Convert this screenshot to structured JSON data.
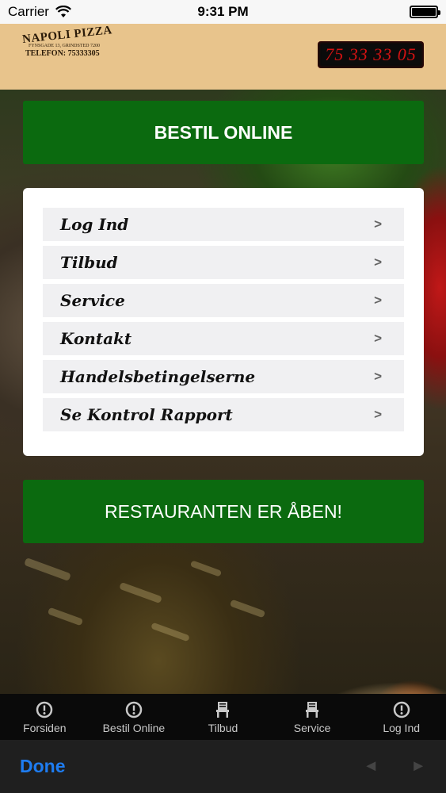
{
  "status_bar": {
    "carrier": "Carrier",
    "time": "9:31 PM"
  },
  "header": {
    "logo": {
      "title": "NAPOLI PIZZA",
      "address": "FYNSGADE 13, GRINDSTED 7200",
      "phone": "TELEFON: 75333305"
    },
    "phone_display": "75 33 33 05"
  },
  "order_button": "BESTIL ONLINE",
  "menu": {
    "items": [
      {
        "label": "Log Ind",
        "arrow": ">"
      },
      {
        "label": "Tilbud",
        "arrow": ">"
      },
      {
        "label": "Service",
        "arrow": ">"
      },
      {
        "label": "Kontakt",
        "arrow": ">"
      },
      {
        "label": "Handelsbetingelserne",
        "arrow": ">"
      },
      {
        "label": "Se Kontrol Rapport",
        "arrow": ">"
      }
    ]
  },
  "open_status": "RESTAURANTEN ER ÅBEN!",
  "tabbar": {
    "tabs": [
      {
        "label": "Forsiden",
        "icon": "info-circle-icon"
      },
      {
        "label": "Bestil Online",
        "icon": "info-circle-icon"
      },
      {
        "label": "Tilbud",
        "icon": "chair-icon"
      },
      {
        "label": "Service",
        "icon": "chair-icon"
      },
      {
        "label": "Log Ind",
        "icon": "info-circle-icon"
      }
    ]
  },
  "toolbar": {
    "done": "Done",
    "back": "◄",
    "forward": "►"
  },
  "colors": {
    "header_bg": "#e8c48c",
    "green": "#0b6a0f",
    "phone_digits": "#d31212",
    "done_blue": "#1e7cf0"
  }
}
